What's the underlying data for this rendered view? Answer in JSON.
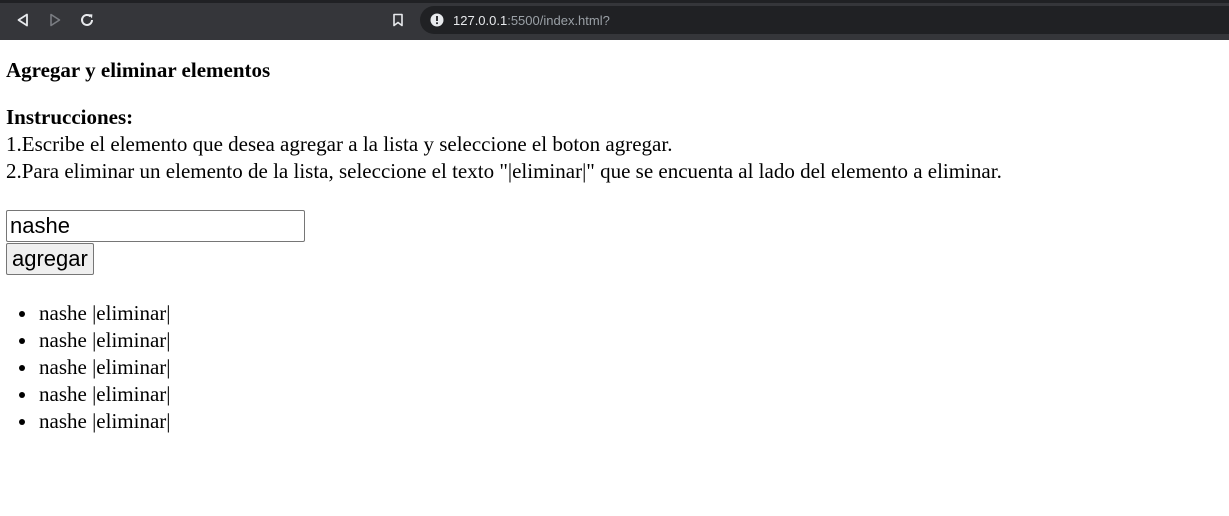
{
  "browser": {
    "url_host": "127.0.0.1",
    "url_rest": ":5500/index.html?"
  },
  "page": {
    "title": "Agregar y eliminar elementos",
    "instructions_heading": "Instrucciones:",
    "instruction_1": "1.Escribe el elemento que desea agregar a la lista y seleccione el boton agregar.",
    "instruction_2": "2.Para eliminar un elemento de la lista, seleccione el texto \"|eliminar|\" que se encuenta al lado del elemento a eliminar."
  },
  "form": {
    "input_value": "nashe",
    "add_label": "agregar"
  },
  "list": {
    "items": [
      {
        "text": "nashe ",
        "delete_label": "|eliminar|"
      },
      {
        "text": "nashe ",
        "delete_label": "|eliminar|"
      },
      {
        "text": "nashe ",
        "delete_label": "|eliminar|"
      },
      {
        "text": "nashe ",
        "delete_label": "|eliminar|"
      },
      {
        "text": "nashe ",
        "delete_label": "|eliminar|"
      }
    ]
  }
}
